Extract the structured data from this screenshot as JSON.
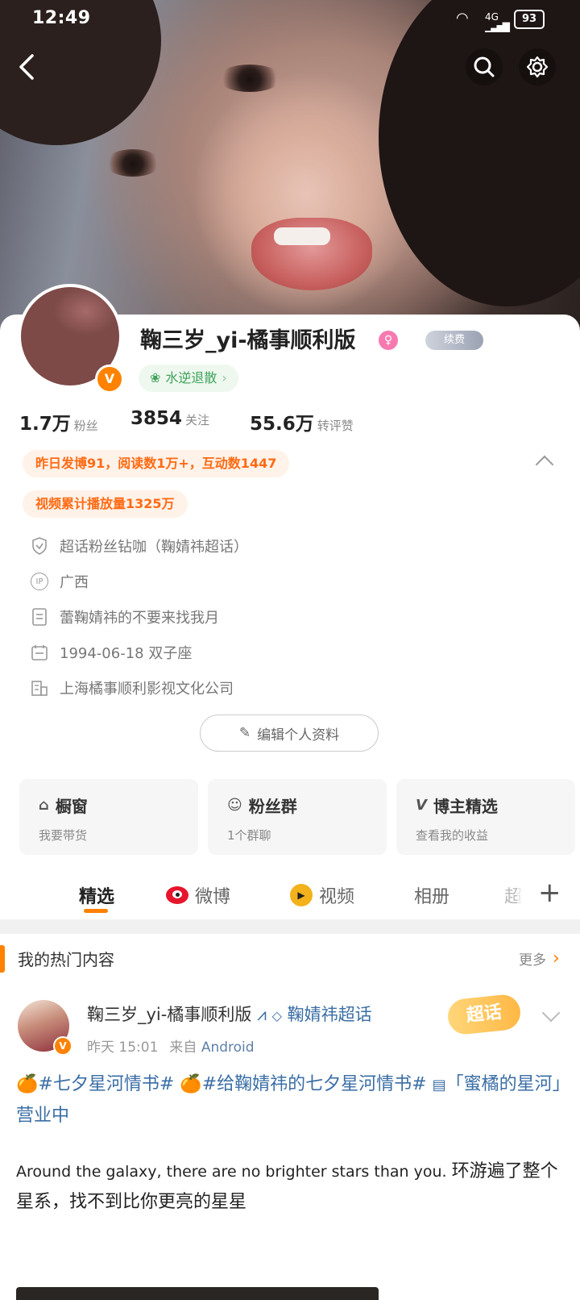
{
  "status_bar": {
    "time": "12:49",
    "signal": "4G",
    "battery": "93"
  },
  "profile": {
    "name": "鞠三岁_yi-橘事顺利版",
    "badge_label": "续费",
    "tag": "水逆退散",
    "stats": [
      {
        "value": "1.7万",
        "label": "粉丝"
      },
      {
        "value": "3854",
        "label": "关注"
      },
      {
        "value": "55.6万",
        "label": "转评赞"
      }
    ],
    "highlights": [
      "昨日发博91，阅读数1万+，互动数1447",
      "视频累计播放量1325万"
    ],
    "info": [
      {
        "icon": "shield-icon",
        "text": "超话粉丝钻咖（鞠婧祎超话）"
      },
      {
        "icon": "ip-location-icon",
        "icon_text": "IP",
        "text": "广西"
      },
      {
        "icon": "document-icon",
        "text": "蕾鞠婧祎的不要来找我月"
      },
      {
        "icon": "calendar-icon",
        "text": "1994-06-18 双子座"
      },
      {
        "icon": "building-icon",
        "text": "上海橘事顺利影视文化公司"
      }
    ],
    "edit_label": "编辑个人资料"
  },
  "features": [
    {
      "title": "橱窗",
      "subtitle": "我要带货",
      "icon": "shop-window-icon"
    },
    {
      "title": "粉丝群",
      "subtitle": "1个群聊",
      "icon": "group-icon"
    },
    {
      "title": "博主精选",
      "subtitle": "查看我的收益",
      "icon": "v-select-icon"
    }
  ],
  "tabs": [
    "精选",
    "微博",
    "视频",
    "相册",
    "超"
  ],
  "section": {
    "title": "我的热门内容",
    "more": "更多"
  },
  "post": {
    "author": "鞠三岁_yi-橘事顺利版",
    "topic": "鞠婧祎超话",
    "super_label": "超话",
    "time": "昨天 15:01",
    "from_label": "来自",
    "source": "Android",
    "tag1": "#七夕星河情书#",
    "tag2": "#给鞠婧祎的七夕星河情书#",
    "link_text": "「蜜橘的星河」营业中",
    "english": "Around the galaxy, there are no brighter stars than you.",
    "chinese": "环游遍了整个星系，找不到比你更亮的星星"
  },
  "colors": {
    "accent": "#ff8200",
    "link": "#3a6ea5",
    "highlight_bg": "#fff2e8"
  }
}
